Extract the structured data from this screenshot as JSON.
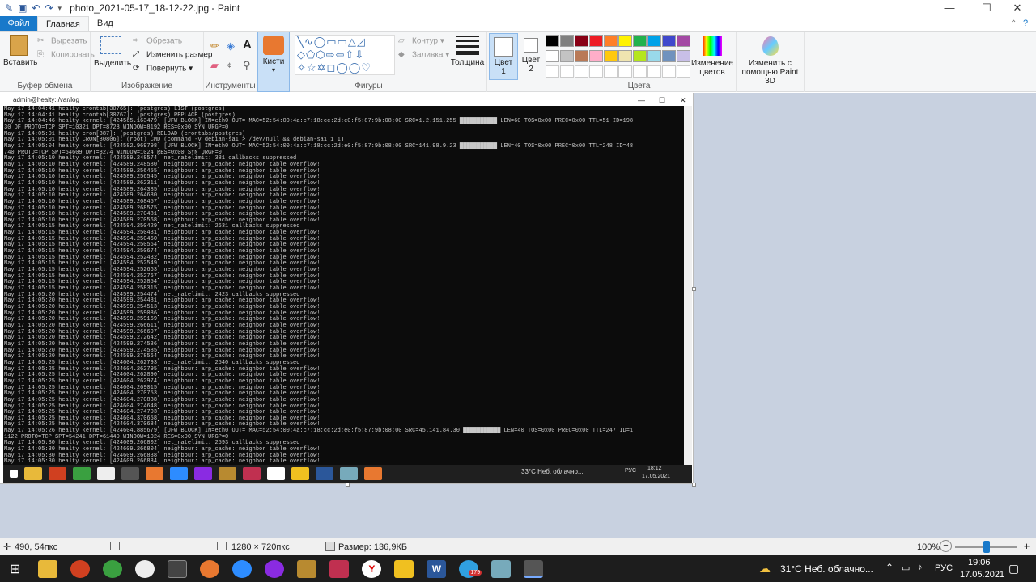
{
  "titlebar": {
    "title": "photo_2021-05-17_18-12-22.jpg - Paint",
    "min": "—",
    "max": "☐",
    "close": "✕"
  },
  "tabs": {
    "file": "Файл",
    "home": "Главная",
    "view": "Вид"
  },
  "ribbon": {
    "clipboard": {
      "paste": "Вставить",
      "cut": "Вырезать",
      "copy": "Копировать",
      "label": "Буфер обмена"
    },
    "image": {
      "select": "Выделить",
      "crop": "Обрезать",
      "resize": "Изменить размер",
      "rotate": "Повернуть",
      "label": "Изображение"
    },
    "tools": {
      "label": "Инструменты"
    },
    "brushes": {
      "label": "Кисти"
    },
    "shapes": {
      "outline": "Контур",
      "fill": "Заливка",
      "label": "Фигуры"
    },
    "size": {
      "label": "Толщина"
    },
    "color1": {
      "label": "Цвет",
      "num": "1"
    },
    "color2": {
      "label": "Цвет",
      "num": "2"
    },
    "colors": {
      "label": "Цвета",
      "edit": "Изменение цветов",
      "swatches": [
        "#000000",
        "#7f7f7f",
        "#880015",
        "#ed1c24",
        "#ff7f27",
        "#fff200",
        "#22b14c",
        "#00a2e8",
        "#3f48cc",
        "#a349a4",
        "#ffffff",
        "#c3c3c3",
        "#b97a57",
        "#ffaec9",
        "#ffc90e",
        "#efe4b0",
        "#b5e61d",
        "#99d9ea",
        "#7092be",
        "#c8bfe7"
      ]
    },
    "paint3d": {
      "label": "Изменить с помощью Paint 3D"
    }
  },
  "terminal": {
    "title": "admin@healty: /var/log",
    "lines": [
      "May 17 14:04:41 healty crontab[30765]: (postgres) LIST (postgres)",
      "May 17 14:04:41 healty crontab[30767]: (postgres) REPLACE (postgres)",
      "May 17 14:04:46 healty kernel: [424565.163479] [UFW BLOCK] IN=eth0 OUT= MAC=52:54:00:4a:c7:18:cc:2d:e0:f5:87:9b:08:00 SRC=1.2.151.255 ███████████ LEN=60 TOS=0x00 PREC=0x00 TTL=51 ID=198",
      "30 DF PROTO=TCP SPT=10321 DPT=8728 WINDOW=8192 RES=0x00 SYN URGP=0",
      "May 17 14:05:01 healty cron[387]: (postgres) RELOAD (crontabs/postgres)",
      "May 17 14:05:01 healty CRON[30806]: (root) CMD (command -v debian-sa1 > /dev/null && debian-sa1 1 1)",
      "May 17 14:05:04 healty kernel: [424582.969798] [UFW BLOCK] IN=eth0 OUT= MAC=52:54:00:4a:c7:18:cc:2d:e0:f5:87:9b:08:00 SRC=141.98.9.23 ███████████ LEN=40 TOS=0x00 PREC=0x00 TTL=248 ID=48",
      "740 PROTO=TCP SPT=54609 DPT=8274 WINDOW=1024 RES=0x00 SYN URGP=0",
      "May 17 14:05:10 healty kernel: [424589.248574] net_ratelimit: 381 callbacks suppressed",
      "May 17 14:05:10 healty kernel: [424589.248580] neighbour: arp_cache: neighbor table overflow!",
      "May 17 14:05:10 healty kernel: [424589.256455] neighbour: arp_cache: neighbor table overflow!",
      "May 17 14:05:10 healty kernel: [424589.256545] neighbour: arp_cache: neighbor table overflow!",
      "May 17 14:05:10 healty kernel: [424589.262311] neighbour: arp_cache: neighbor table overflow!",
      "May 17 14:05:10 healty kernel: [424589.264385] neighbour: arp_cache: neighbor table overflow!",
      "May 17 14:05:10 healty kernel: [424589.264680] neighbour: arp_cache: neighbor table overflow!",
      "May 17 14:05:10 healty kernel: [424589.268457] neighbour: arp_cache: neighbor table overflow!",
      "May 17 14:05:10 healty kernel: [424589.268575] neighbour: arp_cache: neighbor table overflow!",
      "May 17 14:05:10 healty kernel: [424589.270481] neighbour: arp_cache: neighbor table overflow!",
      "May 17 14:05:10 healty kernel: [424589.270568] neighbour: arp_cache: neighbor table overflow!",
      "May 17 14:05:15 healty kernel: [424594.250429] net_ratelimit: 2631 callbacks suppressed",
      "May 17 14:05:15 healty kernel: [424594.250431] neighbour: arp_cache: neighbor table overflow!",
      "May 17 14:05:15 healty kernel: [424594.250460] neighbour: arp_cache: neighbor table overflow!",
      "May 17 14:05:15 healty kernel: [424594.250564] neighbour: arp_cache: neighbor table overflow!",
      "May 17 14:05:15 healty kernel: [424594.250674] neighbour: arp_cache: neighbor table overflow!",
      "May 17 14:05:15 healty kernel: [424594.252432] neighbour: arp_cache: neighbor table overflow!",
      "May 17 14:05:15 healty kernel: [424594.252549] neighbour: arp_cache: neighbor table overflow!",
      "May 17 14:05:15 healty kernel: [424594.252663] neighbour: arp_cache: neighbor table overflow!",
      "May 17 14:05:15 healty kernel: [424594.252767] neighbour: arp_cache: neighbor table overflow!",
      "May 17 14:05:15 healty kernel: [424594.252854] neighbour: arp_cache: neighbor table overflow!",
      "May 17 14:05:15 healty kernel: [424594.258315] neighbour: arp_cache: neighbor table overflow!",
      "May 17 14:05:20 healty kernel: [424599.254474] net_ratelimit: 2423 callbacks suppressed",
      "May 17 14:05:20 healty kernel: [424599.254481] neighbour: arp_cache: neighbor table overflow!",
      "May 17 14:05:20 healty kernel: [424599.254513] neighbour: arp_cache: neighbor table overflow!",
      "May 17 14:05:20 healty kernel: [424599.259086] neighbour: arp_cache: neighbor table overflow!",
      "May 17 14:05:20 healty kernel: [424599.259169] neighbour: arp_cache: neighbor table overflow!",
      "May 17 14:05:20 healty kernel: [424599.266611] neighbour: arp_cache: neighbor table overflow!",
      "May 17 14:05:20 healty kernel: [424599.266697] neighbour: arp_cache: neighbor table overflow!",
      "May 17 14:05:20 healty kernel: [424599.272642] neighbour: arp_cache: neighbor table overflow!",
      "May 17 14:05:20 healty kernel: [424599.274536] neighbour: arp_cache: neighbor table overflow!",
      "May 17 14:05:20 healty kernel: [424599.274585] neighbour: arp_cache: neighbor table overflow!",
      "May 17 14:05:20 healty kernel: [424599.278564] neighbour: arp_cache: neighbor table overflow!",
      "May 17 14:05:25 healty kernel: [424604.262793] net_ratelimit: 2540 callbacks suppressed",
      "May 17 14:05:25 healty kernel: [424604.262795] neighbour: arp_cache: neighbor table overflow!",
      "May 17 14:05:25 healty kernel: [424604.262890] neighbour: arp_cache: neighbor table overflow!",
      "May 17 14:05:25 healty kernel: [424604.262974] neighbour: arp_cache: neighbor table overflow!",
      "May 17 14:05:25 healty kernel: [424604.269015] neighbour: arp_cache: neighbor table overflow!",
      "May 17 14:05:25 healty kernel: [424604.270753] neighbour: arp_cache: neighbor table overflow!",
      "May 17 14:05:25 healty kernel: [424604.270838] neighbour: arp_cache: neighbor table overflow!",
      "May 17 14:05:25 healty kernel: [424604.274648] neighbour: arp_cache: neighbor table overflow!",
      "May 17 14:05:25 healty kernel: [424604.274703] neighbour: arp_cache: neighbor table overflow!",
      "May 17 14:05:25 healty kernel: [424604.370658] neighbour: arp_cache: neighbor table overflow!",
      "May 17 14:05:25 healty kernel: [424604.370684] neighbour: arp_cache: neighbor table overflow!",
      "May 17 14:05:26 healty kernel: [424604.885679] [UFW BLOCK] IN=eth0 OUT= MAC=52:54:00:4a:c7:18:cc:2d:e0:f5:87:9b:08:00 SRC=45.141.84.30 ███████████ LEN=40 TOS=0x00 PREC=0x00 TTL=247 ID=1",
      "1122 PROTO=TCP SPT=54241 DPT=61440 WINDOW=1024 RES=0x00 SYN URGP=0",
      "May 17 14:05:30 healty kernel: [424609.266802] net_ratelimit: 2593 callbacks suppressed",
      "May 17 14:05:30 healty kernel: [424609.266804] neighbour: arp_cache: neighbor table overflow!",
      "May 17 14:05:30 healty kernel: [424609.266838] neighbour: arp_cache: neighbor table overflow!",
      "May 17 14:05:30 healty kernel: [424609.266884] neighbour: arp_cache: neighbor table overflow!"
    ]
  },
  "inner_tray": {
    "weather": "33°C Неб. облачно...",
    "lang": "РУС",
    "time": "18:12",
    "date": "17.05.2021"
  },
  "statusbar": {
    "cursor": "490, 54пкс",
    "dims": "1280 × 720пкс",
    "size": "Размер: 136,9КБ",
    "zoom": "100%",
    "minus": "−",
    "plus": "+"
  },
  "taskbar": {
    "weather": "31°C Неб. облачно...",
    "lang": "РУС",
    "time": "19:06",
    "date": "17.05.2021",
    "badge": "179"
  }
}
